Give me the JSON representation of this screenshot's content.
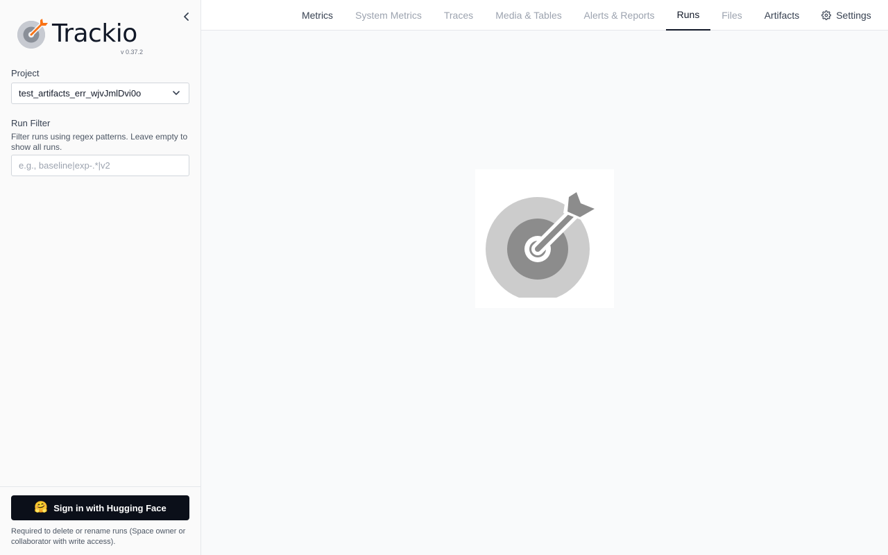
{
  "app": {
    "name": "Trackio",
    "version": "v 0.37.2"
  },
  "sidebar": {
    "project_label": "Project",
    "project_value": "test_artifacts_err_wjvJmlDvi0o",
    "run_filter_label": "Run Filter",
    "run_filter_help": "Filter runs using regex patterns. Leave empty to show all runs.",
    "run_filter_placeholder": "e.g., baseline|exp-.*|v2",
    "run_filter_value": "",
    "signin_label": "Sign in with Hugging Face",
    "signin_emoji": "🤗",
    "signin_note": "Required to delete or rename runs (Space owner or collaborator with write access)."
  },
  "nav": {
    "tabs": [
      {
        "label": "Metrics",
        "state": "enabled"
      },
      {
        "label": "System Metrics",
        "state": "disabled"
      },
      {
        "label": "Traces",
        "state": "disabled"
      },
      {
        "label": "Media & Tables",
        "state": "disabled"
      },
      {
        "label": "Alerts & Reports",
        "state": "disabled"
      },
      {
        "label": "Runs",
        "state": "active"
      },
      {
        "label": "Files",
        "state": "disabled"
      },
      {
        "label": "Artifacts",
        "state": "enabled"
      },
      {
        "label": "Settings",
        "state": "enabled",
        "icon": "gear-icon"
      }
    ]
  },
  "icons": {
    "collapse": "chevron-left-icon",
    "dropdown": "chevron-down-icon",
    "logo": "target-arrow-icon",
    "loader": "target-arrow-icon"
  },
  "colors": {
    "accent": "#f97316",
    "sidebar_bg": "#fafafa",
    "active_tab_underline": "#111827",
    "signin_bg": "#0b0f19"
  }
}
